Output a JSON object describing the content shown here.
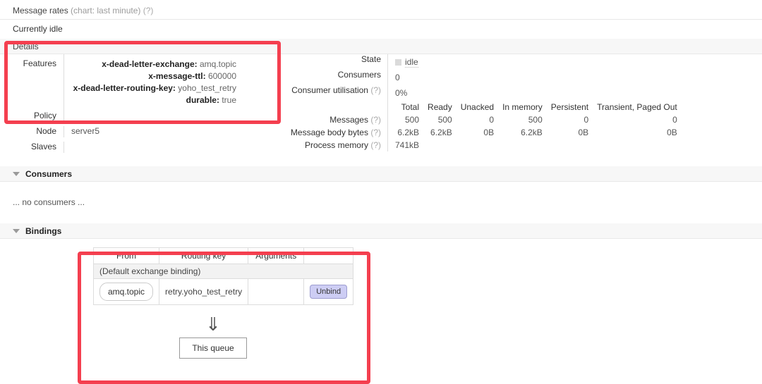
{
  "message_rates": {
    "label": "Message rates",
    "chart_note": "(chart: last minute)",
    "help": "(?)",
    "status": "Currently idle"
  },
  "details": {
    "header": "Details",
    "features": {
      "label": "Features",
      "items": [
        {
          "key": "x-dead-letter-exchange:",
          "value": "amq.topic"
        },
        {
          "key": "x-message-ttl:",
          "value": "600000"
        },
        {
          "key": "x-dead-letter-routing-key:",
          "value": "yoho_test_retry"
        },
        {
          "key": "durable:",
          "value": "true"
        }
      ]
    },
    "policy": {
      "label": "Policy",
      "value": ""
    },
    "node": {
      "label": "Node",
      "value": "server5"
    },
    "slaves": {
      "label": "Slaves",
      "value": ""
    },
    "state": {
      "label": "State",
      "value": "idle"
    },
    "consumers": {
      "label": "Consumers",
      "value": "0"
    },
    "consumer_utilisation": {
      "label": "Consumer utilisation",
      "help": "(?)",
      "value": "0%"
    },
    "stats_table": {
      "columns": [
        "Total",
        "Ready",
        "Unacked",
        "In memory",
        "Persistent",
        "Transient, Paged Out"
      ],
      "rows": [
        {
          "label": "Messages",
          "help": "(?)",
          "values": [
            "500",
            "500",
            "0",
            "500",
            "0",
            "0"
          ]
        },
        {
          "label": "Message body bytes",
          "help": "(?)",
          "values": [
            "6.2kB",
            "6.2kB",
            "0B",
            "6.2kB",
            "0B",
            "0B"
          ]
        },
        {
          "label": "Process memory",
          "help": "(?)",
          "values": [
            "741kB",
            "",
            "",
            "",
            "",
            ""
          ]
        }
      ]
    }
  },
  "consumers_section": {
    "header": "Consumers",
    "empty_text": "... no consumers ..."
  },
  "bindings_section": {
    "header": "Bindings",
    "columns": [
      "From",
      "Routing key",
      "Arguments",
      ""
    ],
    "default_exchange_row": "(Default exchange binding)",
    "rows": [
      {
        "from": "amq.topic",
        "routing_key": "retry.yoho_test_retry",
        "arguments": "",
        "action": "Unbind"
      }
    ],
    "arrow_glyph": "⇓",
    "this_queue": "This queue"
  },
  "colors": {
    "annotation": "#f43f4f",
    "section_band": "#f7f7f7",
    "unbind_button": "#cdcdf4",
    "state_swatch": "#dadada"
  }
}
